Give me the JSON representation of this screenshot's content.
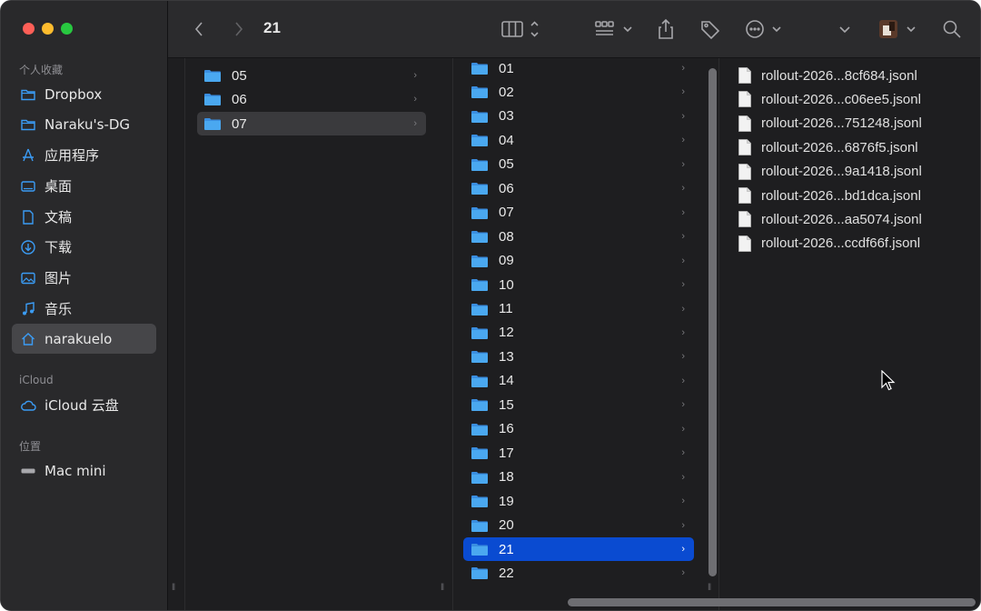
{
  "window": {
    "title": "21"
  },
  "sidebar": {
    "favorites_title": "个人收藏",
    "items": [
      {
        "label": "Dropbox",
        "icon": "folder-icon"
      },
      {
        "label": "Naraku's-DG",
        "icon": "folder-icon"
      },
      {
        "label": "应用程序",
        "icon": "applications-icon"
      },
      {
        "label": "桌面",
        "icon": "desktop-icon"
      },
      {
        "label": "文稿",
        "icon": "document-icon"
      },
      {
        "label": "下载",
        "icon": "download-icon"
      },
      {
        "label": "图片",
        "icon": "photos-icon"
      },
      {
        "label": "音乐",
        "icon": "music-icon"
      },
      {
        "label": "narakuelo",
        "icon": "home-icon",
        "selected": true
      }
    ],
    "icloud_title": "iCloud",
    "icloud_items": [
      {
        "label": "iCloud 云盘",
        "icon": "cloud-icon"
      }
    ],
    "locations_title": "位置",
    "location_items": [
      {
        "label": "Mac mini",
        "icon": "computer-icon"
      }
    ]
  },
  "columns": {
    "months": {
      "items": [
        "05",
        "06",
        "07"
      ],
      "selected": "07"
    },
    "days": {
      "items": [
        "01",
        "02",
        "03",
        "04",
        "05",
        "06",
        "07",
        "08",
        "09",
        "10",
        "11",
        "12",
        "13",
        "14",
        "15",
        "16",
        "17",
        "18",
        "19",
        "20",
        "21",
        "22"
      ],
      "selected": "21"
    },
    "files": {
      "items": [
        "rollout-2026...8cf684.jsonl",
        "rollout-2026...c06ee5.jsonl",
        "rollout-2026...751248.jsonl",
        "rollout-2026...6876f5.jsonl",
        "rollout-2026...9a1418.jsonl",
        "rollout-2026...bd1dca.jsonl",
        "rollout-2026...aa5074.jsonl",
        "rollout-2026...ccdf66f.jsonl"
      ]
    }
  },
  "colors": {
    "selection_blue": "#0a4bd1",
    "folder_blue": "#4aa8f0",
    "sidebar_icon": "#3b9cf5"
  }
}
